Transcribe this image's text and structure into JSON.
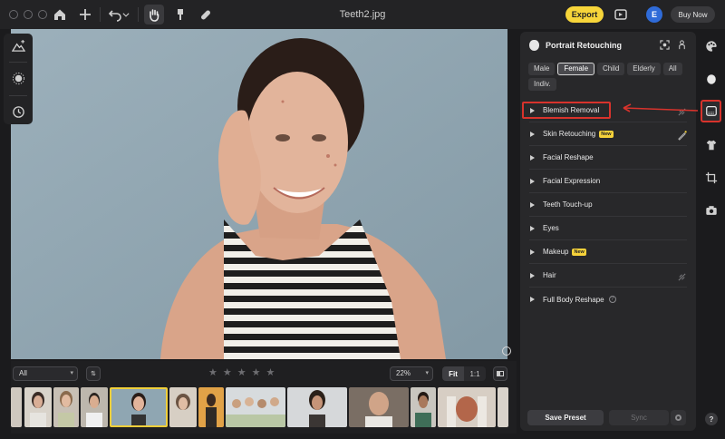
{
  "window": {
    "title": "Teeth2.jpg"
  },
  "topbar": {
    "export_label": "Export",
    "avatar_letter": "E",
    "buy_label": "Buy Now"
  },
  "filmstrip": {
    "filter_value": "All",
    "zoom_value": "22%",
    "fit_label": "Fit",
    "one_to_one_label": "1:1",
    "rating_stars": [
      "★",
      "★",
      "★",
      "★",
      "★"
    ]
  },
  "panel": {
    "title": "Portrait Retouching",
    "chips": [
      "Male",
      "Female",
      "Child",
      "Elderly",
      "All",
      "Indiv."
    ],
    "selected_chip": "Female",
    "items": [
      {
        "label": "Blemish Removal"
      },
      {
        "label": "Skin Retouching",
        "badge": "New"
      },
      {
        "label": "Facial Reshape"
      },
      {
        "label": "Facial Expression"
      },
      {
        "label": "Teeth Touch-up"
      },
      {
        "label": "Eyes"
      },
      {
        "label": "Makeup",
        "badge": "New"
      },
      {
        "label": "Hair"
      },
      {
        "label": "Full Body Reshape",
        "info": "?"
      }
    ],
    "save_preset_label": "Save Preset",
    "sync_label": "Sync"
  },
  "help_label": "?",
  "colors": {
    "accent_yellow": "#f7d53a",
    "highlight_red": "#d8332c",
    "avatar_blue": "#2f6bd8"
  }
}
